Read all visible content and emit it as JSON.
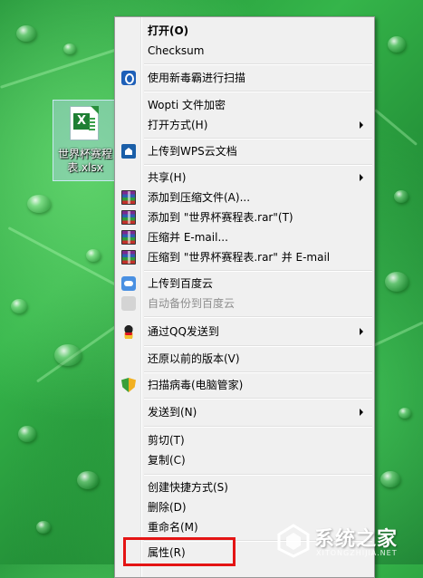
{
  "desktop": {
    "file_label": "世界杯赛程表.xlsx"
  },
  "menu": {
    "items": [
      {
        "label": "打开(O)",
        "icon": "",
        "bold": true
      },
      {
        "label": "Checksum",
        "icon": ""
      },
      {
        "label": "使用新毒霸进行扫描",
        "icon": "antivirus-scan-icon"
      },
      {
        "label": "Wopti 文件加密",
        "icon": ""
      },
      {
        "label": "打开方式(H)",
        "icon": "",
        "submenu": true
      },
      {
        "label": "上传到WPS云文档",
        "icon": "wps-cloud-icon"
      },
      {
        "label": "共享(H)",
        "icon": "",
        "submenu": true
      },
      {
        "label": "添加到压缩文件(A)...",
        "icon": "winrar-icon"
      },
      {
        "label": "添加到 \"世界杯赛程表.rar\"(T)",
        "icon": "winrar-icon"
      },
      {
        "label": "压缩并 E-mail...",
        "icon": "winrar-icon"
      },
      {
        "label": "压缩到 \"世界杯赛程表.rar\" 并 E-mail",
        "icon": "winrar-icon"
      },
      {
        "label": "上传到百度云",
        "icon": "baidu-cloud-icon"
      },
      {
        "label": "自动备份到百度云",
        "icon": "baidu-cloud-icon",
        "disabled": true
      },
      {
        "label": "通过QQ发送到",
        "icon": "qq-icon",
        "submenu": true
      },
      {
        "label": "还原以前的版本(V)",
        "icon": ""
      },
      {
        "label": "扫描病毒(电脑管家)",
        "icon": "pc-manager-shield-icon"
      },
      {
        "label": "发送到(N)",
        "icon": "",
        "submenu": true
      },
      {
        "label": "剪切(T)",
        "icon": ""
      },
      {
        "label": "复制(C)",
        "icon": ""
      },
      {
        "label": "创建快捷方式(S)",
        "icon": ""
      },
      {
        "label": "删除(D)",
        "icon": ""
      },
      {
        "label": "重命名(M)",
        "icon": ""
      },
      {
        "label": "属性(R)",
        "icon": ""
      }
    ]
  },
  "highlight_color": "#e41414",
  "watermark": {
    "title": "系统之家",
    "subtitle": "XITONGZHIJIA.NET"
  }
}
